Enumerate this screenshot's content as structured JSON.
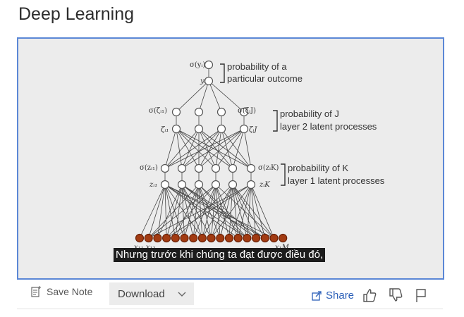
{
  "page": {
    "title": "Deep Learning"
  },
  "video": {
    "subtitle": "Nhưng trước khi chúng ta đạt được điều đó,",
    "diagram": {
      "output_label": "σ(yᵢ)",
      "output_var": "yᵢ",
      "output_desc_1": "probability of a",
      "output_desc_2": "particular outcome",
      "layer2_left_top": "σ(ζᵢ₁)",
      "layer2_left_bot": "ζᵢ₁",
      "layer2_right_top": "σ(ζᵢJ)",
      "layer2_right_bot": "ζᵢJ",
      "layer2_desc_1": "probability of J",
      "layer2_desc_2": "layer 2 latent processes",
      "layer1_left_top": "σ(zᵢ₁)",
      "layer1_left_bot": "zᵢ₁",
      "layer1_right_top": "σ(zᵢK)",
      "layer1_right_bot": "zᵢK",
      "layer1_desc_1": "probability of K",
      "layer1_desc_2": "layer 1 latent processes",
      "input_left": "x₁₁ x₁₂",
      "input_right": "x₁M"
    }
  },
  "toolbar": {
    "save_note_label": "Save Note",
    "download_label": "Download",
    "share_label": "Share"
  },
  "icons": {
    "note": "note-icon",
    "chevron": "chevron-down-icon",
    "share": "share-icon",
    "thumbs_up": "thumbs-up-icon",
    "thumbs_down": "thumbs-down-icon",
    "flag": "flag-icon"
  },
  "colors": {
    "frame_border": "#5b87d6",
    "input_node": "#a23b12",
    "link": "#2b5fb8"
  }
}
